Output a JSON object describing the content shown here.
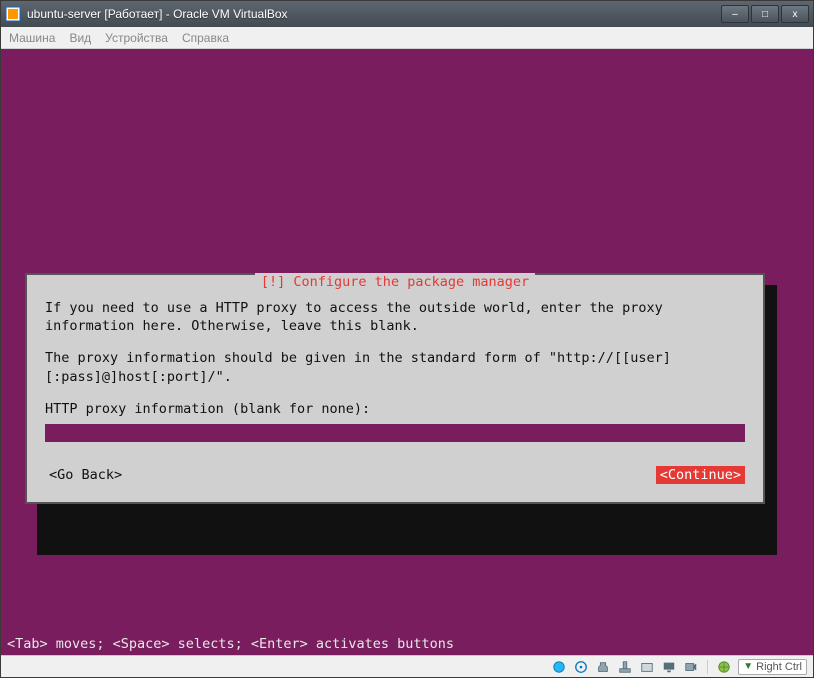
{
  "window": {
    "title": "ubuntu-server [Работает] - Oracle VM VirtualBox",
    "controls": {
      "minimize": "–",
      "maximize": "□",
      "close": "x"
    }
  },
  "menubar": {
    "machine": "Машина",
    "view": "Вид",
    "devices": "Устройства",
    "help": "Справка"
  },
  "dialog": {
    "title_prefix": "[!]",
    "title": "Configure the package manager",
    "para1": "If you need to use a HTTP proxy to access the outside world, enter the proxy information here. Otherwise, leave this blank.",
    "para2": "The proxy information should be given in the standard form of \"http://[[user][:pass]@]host[:port]/\".",
    "prompt": "HTTP proxy information (blank for none):",
    "input_value": "",
    "go_back": "<Go Back>",
    "continue": "<Continue>"
  },
  "hint": "<Tab> moves; <Space> selects; <Enter> activates buttons",
  "statusbar": {
    "hostkey": "Right Ctrl"
  },
  "colors": {
    "installer_bg": "#7a1d5e",
    "dialog_bg": "#d0d0d0",
    "accent_red": "#e53935"
  }
}
